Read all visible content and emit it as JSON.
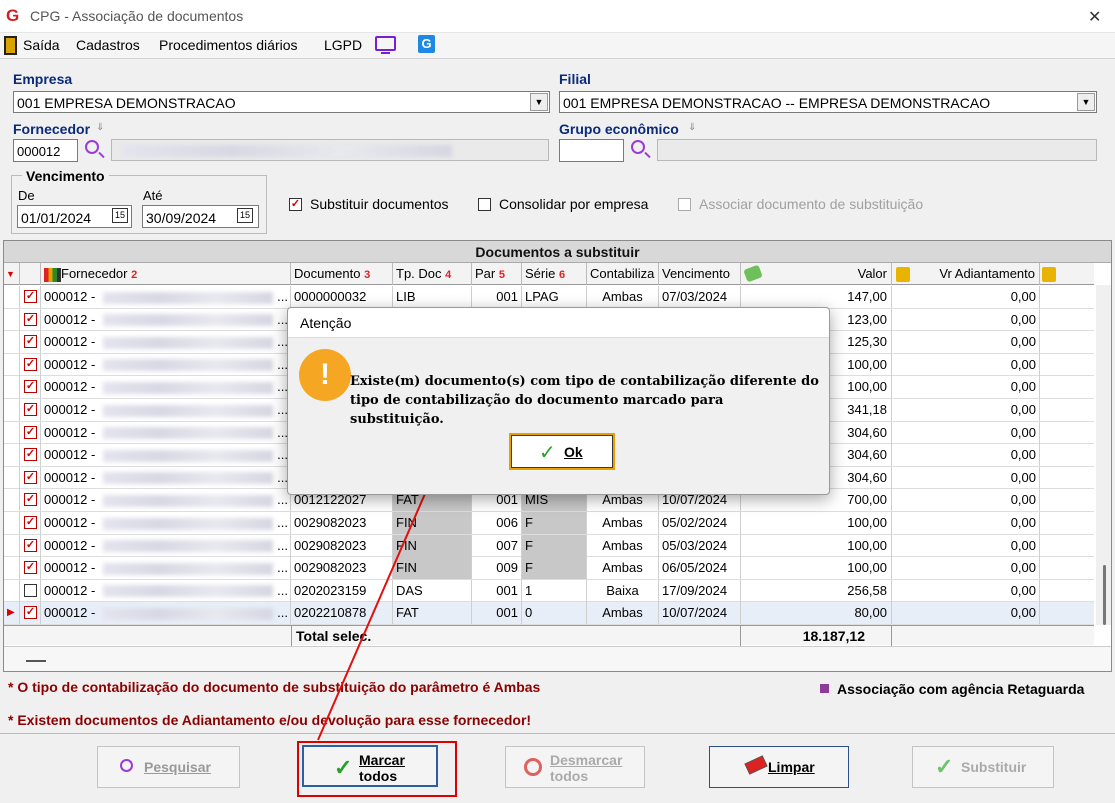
{
  "window": {
    "title": "CPG - Associação de documentos",
    "close": "✕",
    "logo": "G"
  },
  "menu": {
    "items": [
      "Saída",
      "Cadastros",
      "Procedimentos diários",
      "LGPD"
    ]
  },
  "form": {
    "empresa_label": "Empresa",
    "empresa_value": "001 EMPRESA DEMONSTRACAO",
    "filial_label": "Filial",
    "filial_value": "001 EMPRESA DEMONSTRACAO -- EMPRESA DEMONSTRACAO",
    "fornecedor_label": "Fornecedor",
    "fornecedor_code": "000012",
    "grupo_label": "Grupo econômico",
    "vencimento_label": "Vencimento",
    "de_label": "De",
    "de_value": "01/01/2024",
    "ate_label": "Até",
    "ate_value": "30/09/2024",
    "substituir_label": "Substituir documentos",
    "consolidar_label": "Consolidar por empresa",
    "associar_label": "Associar documento de substituição",
    "substituir_checked": true,
    "consolidar_checked": false,
    "associar_checked": false
  },
  "grid": {
    "title": "Documentos a substituir",
    "headers": [
      "Fornecedor",
      "Documento",
      "Tp. Doc",
      "Par",
      "Série",
      "Contabiliza",
      "Vencimento",
      "Valor",
      "Vr Adiantamento"
    ],
    "header_nums": [
      "2",
      "3",
      "4",
      "5",
      "6"
    ],
    "rows": [
      {
        "checked": true,
        "forn": "000012 -",
        "doc": "0000000032",
        "tp": "LIB",
        "par": "001",
        "serie": "LPAG",
        "cont": "Ambas",
        "venc": "07/03/2024",
        "valor": "147,00",
        "adiant": "0,00"
      },
      {
        "checked": true,
        "forn": "000012 -",
        "doc": "",
        "tp": "",
        "par": "",
        "serie": "",
        "cont": "",
        "venc": "",
        "valor": "123,00",
        "adiant": "0,00"
      },
      {
        "checked": true,
        "forn": "000012 -",
        "doc": "",
        "tp": "",
        "par": "",
        "serie": "",
        "cont": "",
        "venc": "",
        "valor": "125,30",
        "adiant": "0,00"
      },
      {
        "checked": true,
        "forn": "000012 -",
        "doc": "",
        "tp": "",
        "par": "",
        "serie": "",
        "cont": "",
        "venc": "",
        "valor": "100,00",
        "adiant": "0,00"
      },
      {
        "checked": true,
        "forn": "000012 -",
        "doc": "",
        "tp": "",
        "par": "",
        "serie": "",
        "cont": "",
        "venc": "",
        "valor": "100,00",
        "adiant": "0,00"
      },
      {
        "checked": true,
        "forn": "000012 -",
        "doc": "",
        "tp": "",
        "par": "",
        "serie": "",
        "cont": "",
        "venc": "",
        "valor": "341,18",
        "adiant": "0,00"
      },
      {
        "checked": true,
        "forn": "000012 -",
        "doc": "",
        "tp": "",
        "par": "",
        "serie": "",
        "cont": "",
        "venc": "",
        "valor": "304,60",
        "adiant": "0,00"
      },
      {
        "checked": true,
        "forn": "000012 -",
        "doc": "",
        "tp": "",
        "par": "",
        "serie": "",
        "cont": "",
        "venc": "",
        "valor": "304,60",
        "adiant": "0,00"
      },
      {
        "checked": true,
        "forn": "000012 -",
        "doc": "",
        "tp": "",
        "par": "",
        "serie": "",
        "cont": "",
        "venc": "",
        "valor": "304,60",
        "adiant": "0,00"
      },
      {
        "checked": true,
        "forn": "000012 -",
        "doc": "0012122027",
        "tp": "FAT",
        "par": "001",
        "serie": "MIS",
        "cont": "Ambas",
        "venc": "10/07/2024",
        "valor": "700,00",
        "adiant": "0,00"
      },
      {
        "checked": true,
        "forn": "000012 -",
        "doc": "0029082023",
        "tp": "FIN",
        "par": "006",
        "serie": "F",
        "cont": "Ambas",
        "venc": "05/02/2024",
        "valor": "100,00",
        "adiant": "0,00"
      },
      {
        "checked": true,
        "forn": "000012 -",
        "doc": "0029082023",
        "tp": "FIN",
        "par": "007",
        "serie": "F",
        "cont": "Ambas",
        "venc": "05/03/2024",
        "valor": "100,00",
        "adiant": "0,00"
      },
      {
        "checked": true,
        "forn": "000012 -",
        "doc": "0029082023",
        "tp": "FIN",
        "par": "009",
        "serie": "F",
        "cont": "Ambas",
        "venc": "06/05/2024",
        "valor": "100,00",
        "adiant": "0,00"
      },
      {
        "checked": false,
        "forn": "000012 -",
        "doc": "0202023159",
        "tp": "DAS",
        "par": "001",
        "serie": "1",
        "cont": "Baixa",
        "venc": "17/09/2024",
        "valor": "256,58",
        "adiant": "0,00"
      },
      {
        "checked": true,
        "forn": "000012 -",
        "doc": "0202210878",
        "tp": "FAT",
        "par": "001",
        "serie": "0",
        "cont": "Ambas",
        "venc": "10/07/2024",
        "valor": "80,00",
        "adiant": "0,00"
      }
    ],
    "total_label": "Total selec.",
    "total_value": "18.187,12"
  },
  "notes": {
    "note1": "* O tipo de contabilização do documento de substituição do parâmetro é Ambas",
    "note2": "* Existem documentos de Adiantamento e/ou devolução para esse fornecedor!",
    "legend": "Associação com agência Retaguarda"
  },
  "buttons": {
    "pesquisar": "Pesquisar",
    "marcar1": "Marcar",
    "marcar2": "todos",
    "desmarcar1": "Desmarcar",
    "desmarcar2": "todos",
    "limpar": "Limpar",
    "substituir": "Substituir"
  },
  "dialog": {
    "title": "Atenção",
    "message": "Existe(m) documento(s) com tipo de contabilização diferente do tipo de contabilização do documento marcado para substituição.",
    "ok": "Ok",
    "icon": "!"
  },
  "colors": {
    "accent_red": "#cc0000",
    "label_blue": "#0a2a7a",
    "note_red": "#8b0000",
    "legend_purple": "#8e3a9b",
    "warning_orange": "#f5a623"
  }
}
